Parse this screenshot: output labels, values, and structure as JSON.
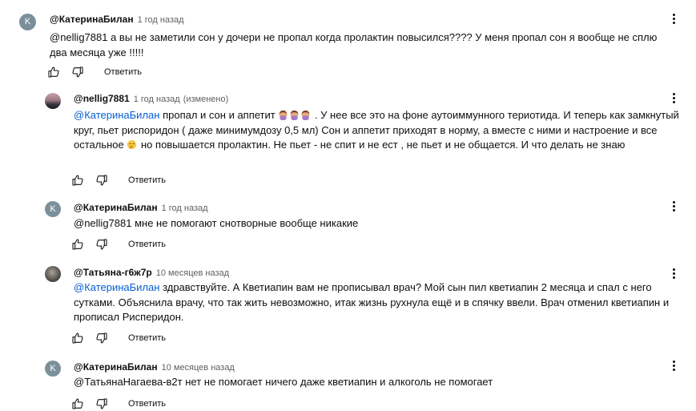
{
  "comments": [
    {
      "avatar_letter": "K",
      "author": "@КатеринаБилан",
      "time": "1 год назад",
      "text": "@nellig7881  а вы не заметили сон у дочери не пропал когда пролактин повысился???? У меня пропал сон я вообще не сплю два месяца уже !!!!!",
      "reply_label": "Ответить"
    },
    {
      "avatar_letter": "",
      "author": "@nellig7881",
      "time": "1 год назад",
      "edited": "(изменено)",
      "mention": "@КатеринаБилан",
      "text_a": "  пропал и сон и аппетит ",
      "text_b": " . У нее все это на фоне аутоиммунного териотида. И теперь как замкнутый круг, пьет риспоридон ( даже минимумдозу 0,5 мл) Сон и аппетит приходят в норму, а вместе с ними и настроение и все остальное ",
      "text_c": " но повышается пролактин. Не пьет - не спит и не ест , не пьет и не общается. И что делать не знаю",
      "reply_label": "Ответить"
    },
    {
      "avatar_letter": "K",
      "author": "@КатеринаБилан",
      "time": "1 год назад",
      "text": "@nellig7881  мне не помогают снотворные вообще никакие",
      "reply_label": "Ответить"
    },
    {
      "avatar_letter": "",
      "author": "@Татьяна-г6ж7р",
      "time": "10 месяцев назад",
      "mention": "@КатеринаБилан",
      "text_a": " здравствуйте. А Кветиапин вам не прописывал врач? Мой сын пил кветиапин 2 месяца и спал с него сутками. Объяснила врачу, что так жить невозможно, итак жизнь рухнула ещё и в спячку ввели. Врач отменил кветиапин и прописал Рисперидон.",
      "reply_label": "Ответить"
    },
    {
      "avatar_letter": "K",
      "author": "@КатеринаБилан",
      "time": "10 месяцев назад",
      "text": "@ТатьянаНагаева-в2т  нет не помогает ничего даже кветиапин и алкоголь не помогает",
      "reply_label": "Ответить"
    }
  ],
  "colors": {
    "mention": "#065fd4",
    "avatar_bg": "#7c909b",
    "text": "#0f0f0f",
    "meta": "#606060"
  },
  "icons": [
    "like-icon",
    "dislike-icon",
    "more-vert-icon",
    "woman-facepalming-emoji",
    "thinking-face-emoji"
  ]
}
